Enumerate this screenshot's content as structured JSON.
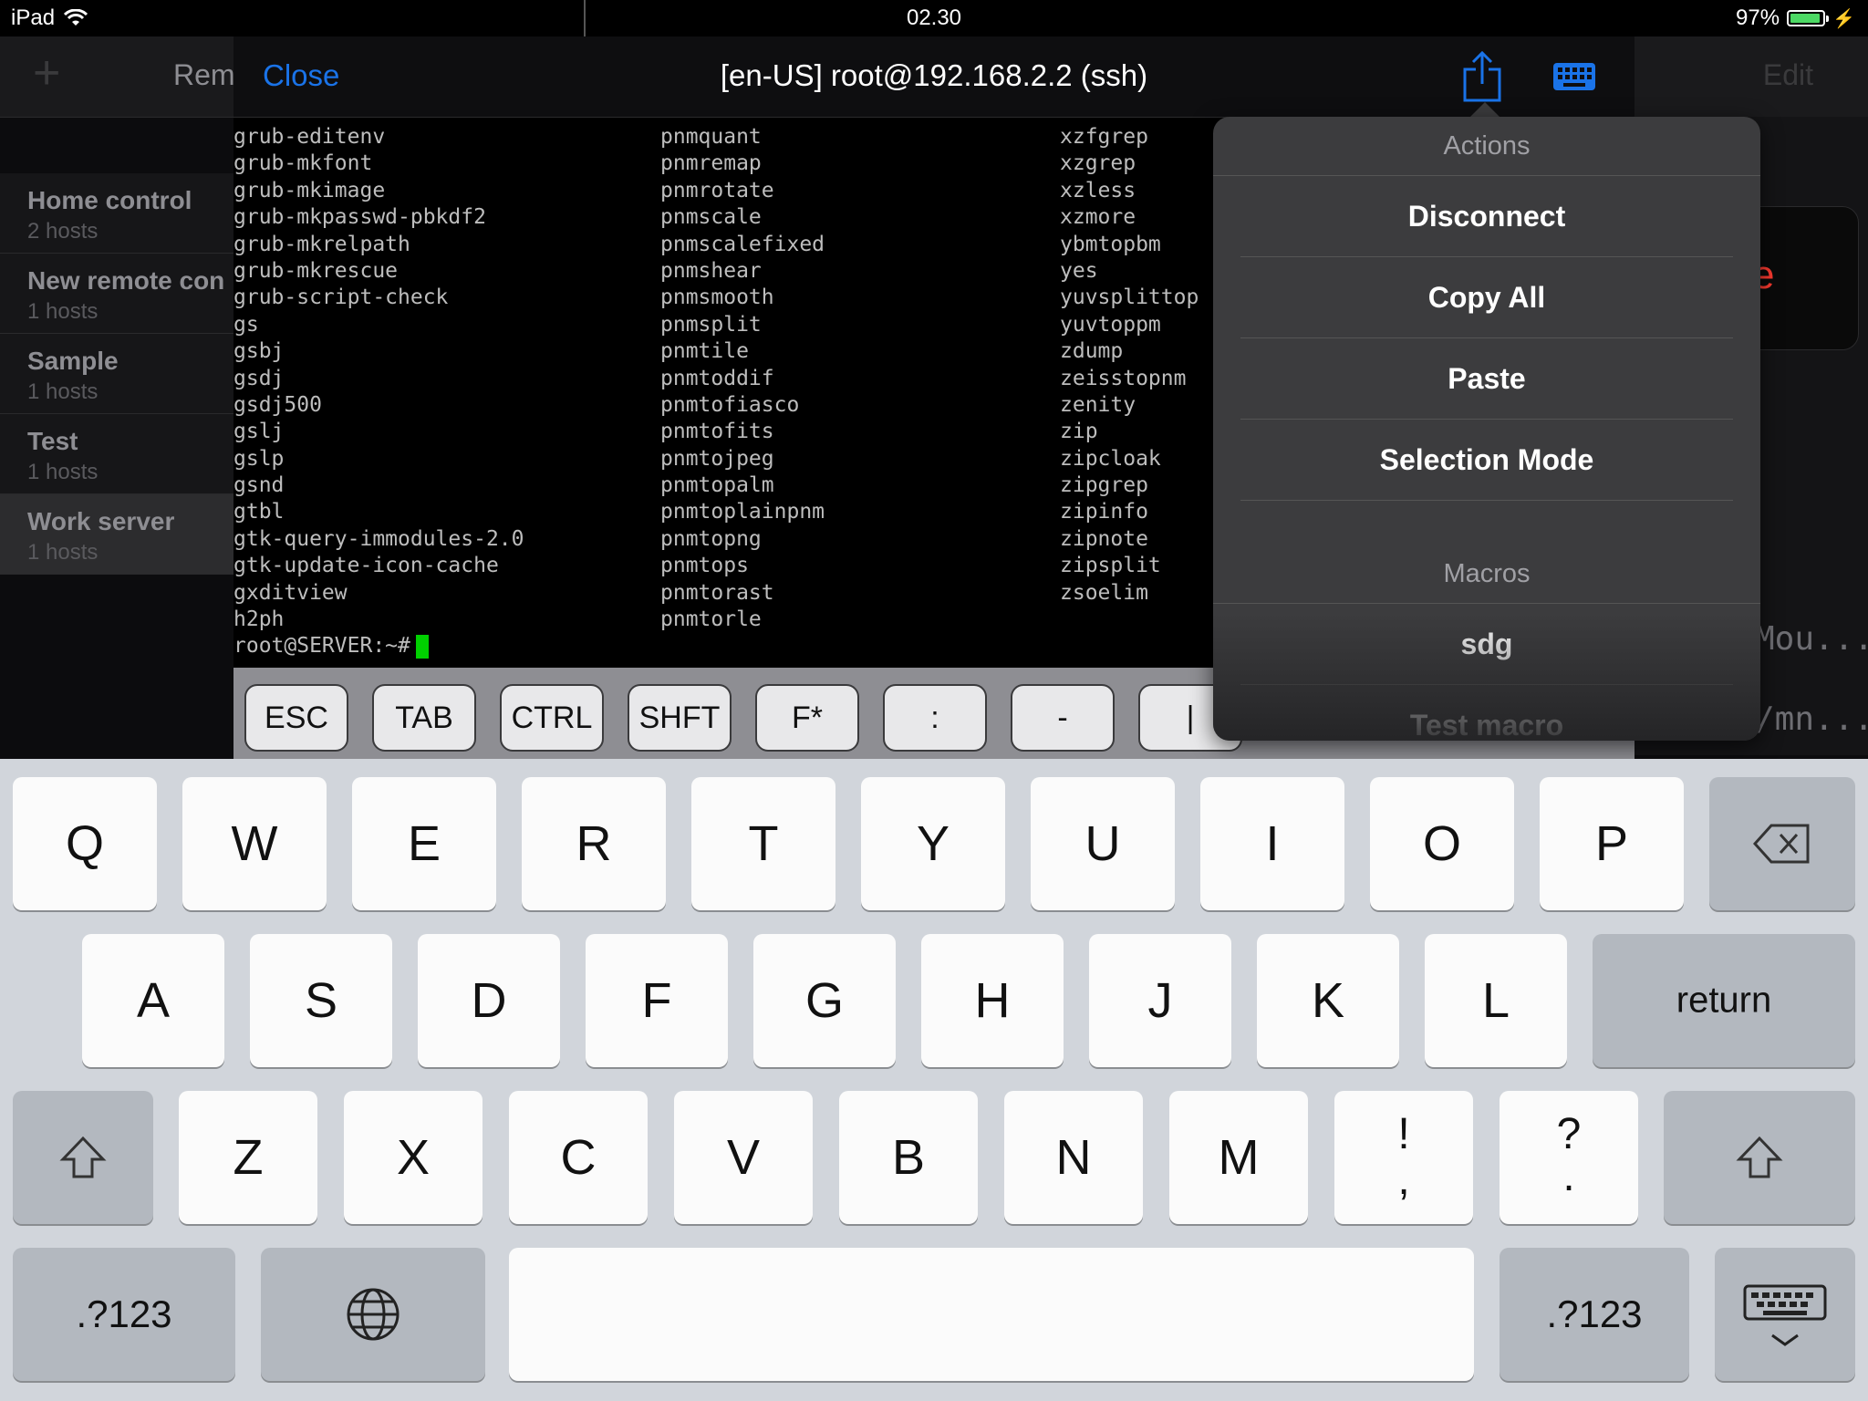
{
  "status_bar": {
    "device": "iPad",
    "time": "02.30",
    "battery": "97%",
    "battery_fill": 0.97
  },
  "background_app": {
    "nav_left": "Rem",
    "nav_right": "Edit",
    "groups": [
      {
        "name": "Home control",
        "hosts": "2 hosts"
      },
      {
        "name": "New remote con",
        "hosts": "1 hosts"
      },
      {
        "name": "Sample",
        "hosts": "1 hosts"
      },
      {
        "name": "Test",
        "hosts": "1 hosts"
      },
      {
        "name": "Work server",
        "hosts": "1 hosts"
      }
    ],
    "right_text_1": "Mou...",
    "right_text_2": "/mn...",
    "card_text": "e"
  },
  "terminal": {
    "close_label": "Close",
    "title": "[en-US] root@192.168.2.2 (ssh)",
    "col1": [
      "grub-editenv",
      "grub-mkfont",
      "grub-mkimage",
      "grub-mkpasswd-pbkdf2",
      "grub-mkrelpath",
      "grub-mkrescue",
      "grub-script-check",
      "gs",
      "gsbj",
      "gsdj",
      "gsdj500",
      "gslj",
      "gslp",
      "gsnd",
      "gtbl",
      "gtk-query-immodules-2.0",
      "gtk-update-icon-cache",
      "gxditview",
      "h2ph"
    ],
    "col2": [
      "pnmquant",
      "pnmremap",
      "pnmrotate",
      "pnmscale",
      "pnmscalefixed",
      "pnmshear",
      "pnmsmooth",
      "pnmsplit",
      "pnmtile",
      "pnmtoddif",
      "pnmtofiasco",
      "pnmtofits",
      "pnmtojpeg",
      "pnmtopalm",
      "pnmtoplainpnm",
      "pnmtopng",
      "pnmtops",
      "pnmtorast",
      "pnmtorle"
    ],
    "col3": [
      "xzfgrep",
      "xzgrep",
      "xzless",
      "xzmore",
      "ybmtopbm",
      "yes",
      "yuvsplittop",
      "yuvtoppm",
      "zdump",
      "zeisstopnm",
      "zenity",
      "zip",
      "zipcloak",
      "zipgrep",
      "zipinfo",
      "zipnote",
      "zipsplit",
      "zsoelim"
    ],
    "prompt": "root@SERVER:~#",
    "special_keys": [
      "ESC",
      "TAB",
      "CTRL",
      "SHFT",
      "F*",
      ":",
      "-",
      "|"
    ]
  },
  "popover": {
    "actions_header": "Actions",
    "actions": [
      "Disconnect",
      "Copy All",
      "Paste",
      "Selection Mode"
    ],
    "macros_header": "Macros",
    "macros": [
      "sdg",
      "Test macro"
    ]
  },
  "keyboard": {
    "row1": [
      "Q",
      "W",
      "E",
      "R",
      "T",
      "Y",
      "U",
      "I",
      "O",
      "P"
    ],
    "row2": [
      "A",
      "S",
      "D",
      "F",
      "G",
      "H",
      "J",
      "K",
      "L"
    ],
    "return_label": "return",
    "row3": [
      "Z",
      "X",
      "C",
      "V",
      "B",
      "N",
      "M"
    ],
    "punct1_top": "!",
    "punct1_bottom": ",",
    "punct2_top": "?",
    "punct2_bottom": ".",
    "numbers_label": ".?123"
  }
}
